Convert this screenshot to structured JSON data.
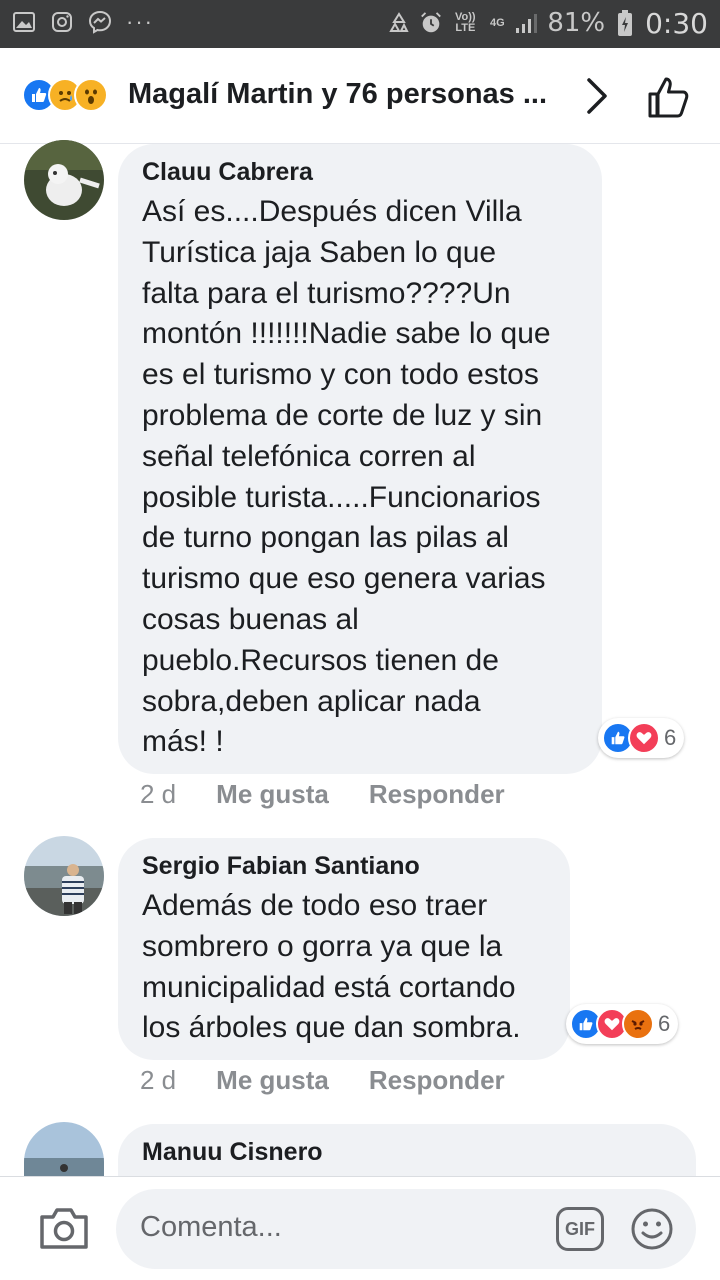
{
  "status_bar": {
    "volte": "Vo)) LTE",
    "network": "4G",
    "battery": "81%",
    "time": "0:30",
    "bg_color": "#3a3b3c"
  },
  "header": {
    "title": "Magalí Martin y 76 personas ...",
    "reactions": [
      "like-icon",
      "sad-icon",
      "wow-icon"
    ]
  },
  "comments": [
    {
      "author": "Clauu Cabrera",
      "text": "Así es....Después dicen Villa\nTurística jaja Saben lo que\nfalta para el turismo????Un\nmontón !!!!!!!Nadie sabe lo que\nes el turismo y con todo estos\nproblema de corte de luz y sin\nseñal telefónica corren al\nposible turista.....Funcionarios\nde turno pongan las pilas al\nturismo que eso genera varias\ncosas buenas al\npueblo.Recursos tienen de\nsobra,deben aplicar nada\nmás! !",
      "reaction_count": "6",
      "reactions": [
        "like-icon",
        "love-icon"
      ],
      "age": "2 d",
      "like_label": "Me gusta",
      "reply_label": "Responder"
    },
    {
      "author": "Sergio Fabian Santiano",
      "text": "Además de todo eso traer\nsombrero o gorra ya que la\nmunicipalidad está cortando\nlos árboles que dan sombra.",
      "reaction_count": "6",
      "reactions": [
        "like-icon",
        "love-icon",
        "angry-icon"
      ],
      "age": "2 d",
      "like_label": "Me gusta",
      "reply_label": "Responder"
    },
    {
      "author": "Manuu Cisnero"
    }
  ],
  "composer": {
    "placeholder": "Comenta...",
    "gif_label": "GIF"
  },
  "colors": {
    "accent": "#1877f2",
    "love": "#f33e58",
    "bubble": "#f0f2f5"
  }
}
